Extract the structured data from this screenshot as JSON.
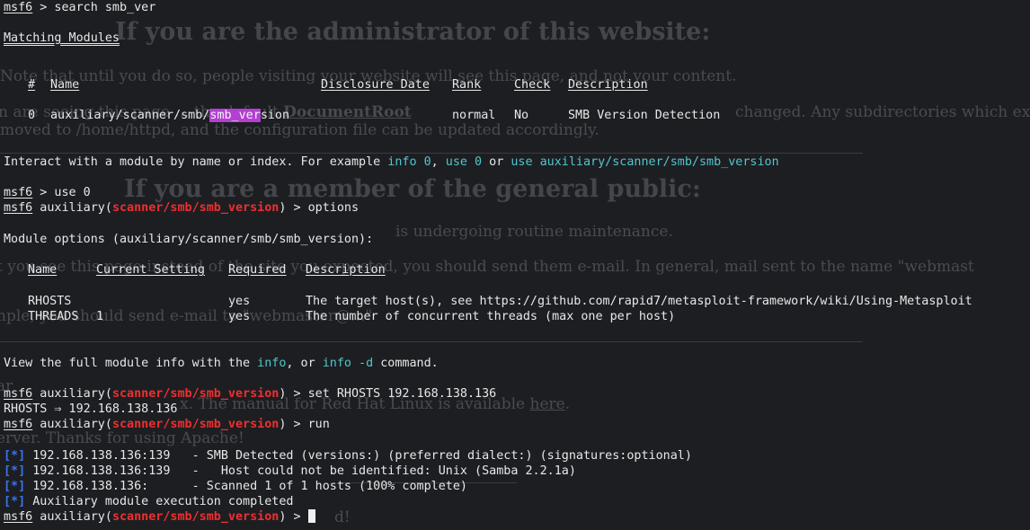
{
  "background_page": {
    "heading1": "If you are the administrator of this website:",
    "para1": "Note that until you do so, people visiting your website will see this page, and not your content.",
    "para2_pre": "n are seeing this page ... the default",
    "para2_link": "DocumentRoot",
    "para2_post": "changed. Any subdirectories which ex",
    "para3": "moved to /home/httpd, and the configuration file can be updated accordingly.",
    "heading2": "If you are a member of the general public:",
    "para4": "is undergoing routine maintenance.",
    "para5": "t you see this page instead of the site you expected, you should send them e-mail. In general, mail sent to the name \"webmast",
    "para6": "nple, you should send e-mail to \"webmaster@...\"",
    "para7": "ar",
    "para8_pre": "x. The manual for Red Hat Linux is available",
    "para8_link": "here",
    "para9": "erver. Thanks for using Apache!",
    "para10": "d!"
  },
  "terminal": {
    "prompt": "msf6",
    "search_cmd": " > search smb_ver",
    "matching_heading": "Matching Modules",
    "search_table": {
      "headers": [
        "#",
        "Name",
        "Disclosure Date",
        "Rank",
        "Check",
        "Description"
      ],
      "row": {
        "index": "0",
        "name_prefix": "auxiliary/scanner/smb/",
        "name_highlight": "smb_ver",
        "name_suffix": "sion",
        "rank": "normal",
        "check": "No",
        "description": "SMB Version Detection"
      }
    },
    "interact_text": "Interact with a module by name or index. For example ",
    "interact_info": "info 0",
    "interact_sep": ", ",
    "interact_use": "use 0",
    "interact_or": " or ",
    "interact_use_full": "use auxiliary/scanner/smb/smb_version",
    "use_cmd": " > use 0",
    "module_prefix": " auxiliary(",
    "module_path": "scanner/smb/smb_version",
    "module_suffix": ")",
    "options_cmd": " > options",
    "module_options_heading": "Module options (auxiliary/scanner/smb/smb_version):",
    "options_table": {
      "headers": [
        "Name",
        "Current Setting",
        "Required",
        "Description"
      ],
      "rows": [
        {
          "name": "RHOSTS",
          "setting": "",
          "required": "yes",
          "description": "The target host(s), see https://github.com/rapid7/metasploit-framework/wiki/Using-Metasploit"
        },
        {
          "name": "THREADS",
          "setting": "1",
          "required": "yes",
          "description": "The number of concurrent threads (max one per host)"
        }
      ]
    },
    "view_text": "View the full module info with the ",
    "view_info": "info",
    "view_or": ", or ",
    "view_info_d": "info -d",
    "view_end": " command.",
    "set_cmd": " > set RHOSTS 192.168.138.136",
    "set_result": "RHOSTS ⇒ 192.168.138.136",
    "run_cmd": " > run",
    "results": [
      {
        "marker": "[*]",
        "text": " 192.168.138.136:139   - SMB Detected (versions:) (preferred dialect:) (signatures:optional)"
      },
      {
        "marker": "[*]",
        "text": " 192.168.138.136:139   -   Host could not be identified: Unix (Samba 2.2.1a)"
      },
      {
        "marker": "[*]",
        "text": " 192.168.138.136:      - Scanned 1 of 1 hosts (100% complete)"
      },
      {
        "marker": "[*]",
        "text": " Auxiliary module execution completed"
      }
    ],
    "final_prompt_suffix": " > "
  },
  "colors": {
    "background": "#1d1e22",
    "prompt_red": "#ef2f2f",
    "keyword_cyan": "#4fc7cd",
    "info_blue": "#3c74e8",
    "search_highlight": "#b43fd3"
  }
}
